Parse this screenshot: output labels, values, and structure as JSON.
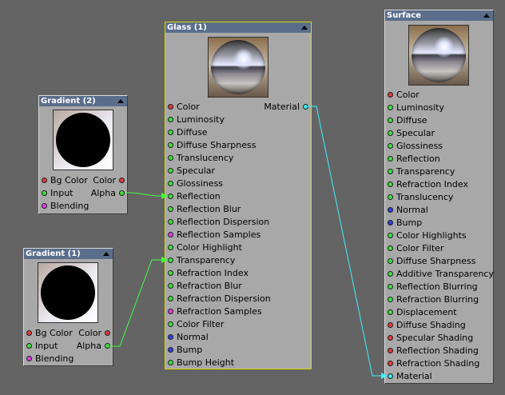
{
  "colors": {
    "canvas": "#646464",
    "node_body": "#a8a8a8",
    "title_bar": "#5a6e8c",
    "selected_border": "#d9d900",
    "scalar_port": "#3fe03f",
    "color_port": "#e23a3a",
    "integer_port": "#e040e0",
    "normal_port": "#3040e0",
    "material_port": "#40e8f0",
    "green_wire": "#40ff40",
    "cyan_wire": "#40f0ff"
  },
  "icons": {
    "collapse": "collapse-arrow-icon",
    "port": "port-dot-icon"
  },
  "gradient2": {
    "title": "Gradient (2)",
    "inputs": [
      {
        "label": "Bg Color",
        "type": "color"
      },
      {
        "label": "Input",
        "type": "scalar"
      },
      {
        "label": "Blending",
        "type": "integer"
      }
    ],
    "outputs": [
      {
        "label": "Color",
        "type": "color"
      },
      {
        "label": "Alpha",
        "type": "scalar"
      }
    ]
  },
  "gradient1": {
    "title": "Gradient (1)",
    "inputs": [
      {
        "label": "Bg Color",
        "type": "color"
      },
      {
        "label": "Input",
        "type": "scalar"
      },
      {
        "label": "Blending",
        "type": "integer"
      }
    ],
    "outputs": [
      {
        "label": "Color",
        "type": "color"
      },
      {
        "label": "Alpha",
        "type": "scalar"
      }
    ]
  },
  "glass": {
    "title": "Glass (1)",
    "output": {
      "label": "Material",
      "type": "material"
    },
    "inputs": [
      {
        "label": "Color",
        "type": "color"
      },
      {
        "label": "Luminosity",
        "type": "scalar"
      },
      {
        "label": "Diffuse",
        "type": "scalar"
      },
      {
        "label": "Diffuse Sharpness",
        "type": "scalar"
      },
      {
        "label": "Translucency",
        "type": "scalar"
      },
      {
        "label": "Specular",
        "type": "scalar"
      },
      {
        "label": "Glossiness",
        "type": "scalar"
      },
      {
        "label": "Reflection",
        "type": "scalar"
      },
      {
        "label": "Reflection Blur",
        "type": "scalar"
      },
      {
        "label": "Reflection Dispersion",
        "type": "scalar"
      },
      {
        "label": "Reflection Samples",
        "type": "integer"
      },
      {
        "label": "Color Highlight",
        "type": "scalar"
      },
      {
        "label": "Transparency",
        "type": "scalar"
      },
      {
        "label": "Refraction Index",
        "type": "scalar"
      },
      {
        "label": "Refraction Blur",
        "type": "scalar"
      },
      {
        "label": "Refraction Dispersion",
        "type": "scalar"
      },
      {
        "label": "Refraction Samples",
        "type": "integer"
      },
      {
        "label": "Color Filter",
        "type": "scalar"
      },
      {
        "label": "Normal",
        "type": "normal"
      },
      {
        "label": "Bump",
        "type": "normal"
      },
      {
        "label": "Bump Height",
        "type": "scalar"
      }
    ]
  },
  "surface": {
    "title": "Surface",
    "inputs": [
      {
        "label": "Color",
        "type": "color"
      },
      {
        "label": "Luminosity",
        "type": "scalar"
      },
      {
        "label": "Diffuse",
        "type": "scalar"
      },
      {
        "label": "Specular",
        "type": "scalar"
      },
      {
        "label": "Glossiness",
        "type": "scalar"
      },
      {
        "label": "Reflection",
        "type": "scalar"
      },
      {
        "label": "Transparency",
        "type": "scalar"
      },
      {
        "label": "Refraction Index",
        "type": "scalar"
      },
      {
        "label": "Translucency",
        "type": "scalar"
      },
      {
        "label": "Normal",
        "type": "normal"
      },
      {
        "label": "Bump",
        "type": "normal"
      },
      {
        "label": "Color Highlights",
        "type": "scalar"
      },
      {
        "label": "Color Filter",
        "type": "scalar"
      },
      {
        "label": "Diffuse Sharpness",
        "type": "scalar"
      },
      {
        "label": "Additive Transparency",
        "type": "scalar"
      },
      {
        "label": "Reflection Blurring",
        "type": "scalar"
      },
      {
        "label": "Refraction Blurring",
        "type": "scalar"
      },
      {
        "label": "Displacement",
        "type": "scalar"
      },
      {
        "label": "Diffuse Shading",
        "type": "color"
      },
      {
        "label": "Specular Shading",
        "type": "color"
      },
      {
        "label": "Reflection Shading",
        "type": "color"
      },
      {
        "label": "Refraction Shading",
        "type": "color"
      },
      {
        "label": "Material",
        "type": "material"
      }
    ]
  }
}
